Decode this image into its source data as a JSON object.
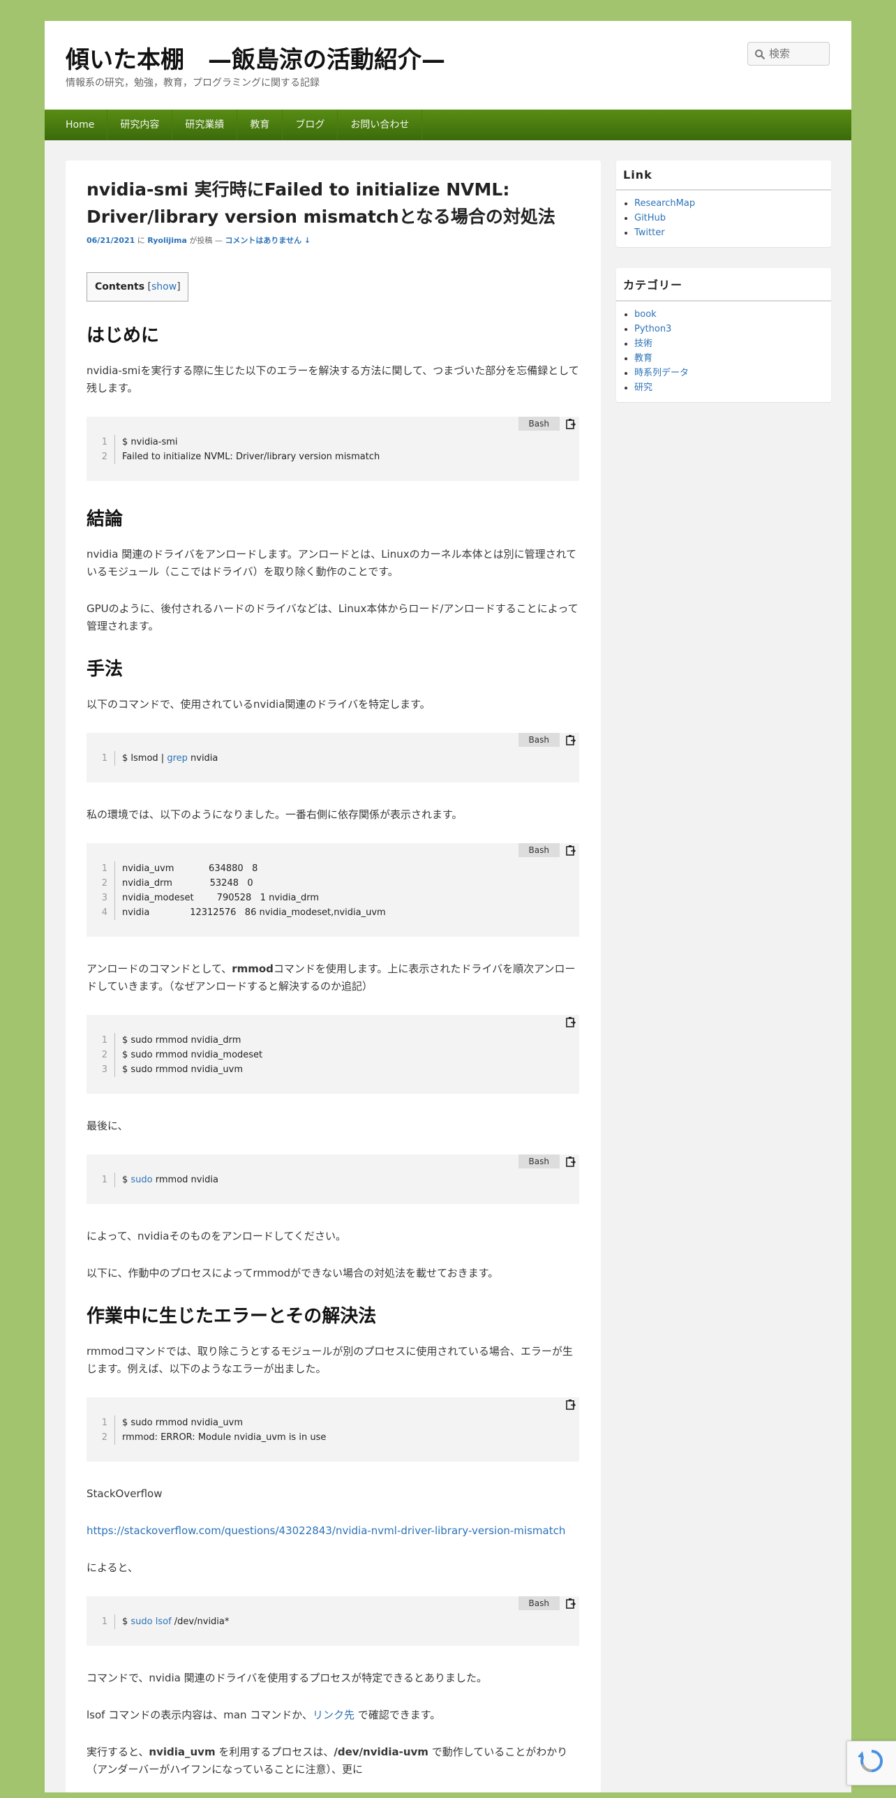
{
  "header": {
    "site_title": "傾いた本棚　—飯島涼の活動紹介—",
    "site_description": "情報系の研究，勉強，教育，プログラミングに関する記録",
    "search_placeholder": "検索"
  },
  "nav": {
    "items": [
      "Home",
      "研究内容",
      "研究業績",
      "教育",
      "ブログ",
      "お問い合わせ"
    ]
  },
  "post": {
    "title": "nvidia-smi 実行時にFailed to initialize NVML: Driver/library version mismatchとなる場合の対処法",
    "meta": {
      "date": "06/21/2021",
      "date_suffix": "に",
      "author": "Ryolijima",
      "author_suffix": "が投稿 —",
      "comments": "コメントはありません ↓"
    },
    "toc": {
      "label": "Contents",
      "toggle_open": "[",
      "toggle": "show",
      "toggle_close": "]"
    },
    "h_intro": "はじめに",
    "p_intro": "nvidia-smiを実行する際に生じた以下のエラーを解決する方法に関して、つまづいた部分を忘備録として残します。",
    "code1": {
      "lang": "Bash",
      "lines": [
        [
          "1",
          "$ nvidia-smi"
        ],
        [
          "2",
          "Failed to initialize NVML: Driver/library version mismatch"
        ]
      ]
    },
    "h_conclusion": "結論",
    "p_conclusion1": "nvidia 関連のドライバをアンロードします。アンロードとは、Linuxのカーネル本体とは別に管理されているモジュール（ここではドライバ）を取り除く動作のことです。",
    "p_conclusion2": "GPUのように、後付されるハードのドライバなどは、Linux本体からロード/アンロードすることによって管理されます。",
    "h_method": "手法",
    "p_method": "以下のコマンドで、使用されているnvidia関連のドライバを特定します。",
    "code2": {
      "lang": "Bash",
      "ln": "1",
      "prefix": "$ lsmod | ",
      "kw": "grep",
      "suffix": " nvidia"
    },
    "p_env": "私の環境では、以下のようになりました。一番右側に依存関係が表示されます。",
    "code3": {
      "lang": "Bash",
      "lines": [
        [
          "1",
          "nvidia_uvm            634880   8"
        ],
        [
          "2",
          "nvidia_drm             53248   0"
        ],
        [
          "3",
          "nvidia_modeset        790528   1 nvidia_drm"
        ],
        [
          "4",
          "nvidia              12312576   86 nvidia_modeset,nvidia_uvm"
        ]
      ]
    },
    "p_unload_a": "アンロードのコマンドとして、",
    "p_unload_b": "rmmod",
    "p_unload_c": "コマンドを使用します。上に表示されたドライバを順次アンロードしていきます。（なぜアンロードすると解決するのか追記）",
    "code4": {
      "lines": [
        [
          "1",
          "$ sudo rmmod nvidia_drm"
        ],
        [
          "2",
          "$ sudo rmmod nvidia_modeset"
        ],
        [
          "3",
          "$ sudo rmmod nvidia_uvm"
        ]
      ]
    },
    "p_finally": "最後に、",
    "code5": {
      "lang": "Bash",
      "ln": "1",
      "prefix": "$ ",
      "kw": "sudo",
      "suffix": " rmmod nvidia"
    },
    "p_after1": "によって、nvidiaそのものをアンロードしてください。",
    "p_after2": "以下に、作動中のプロセスによってrmmodができない場合の対処法を載せておきます。",
    "h_error": "作業中に生じたエラーとその解決法",
    "p_error": "rmmodコマンドでは、取り除こうとするモジュールが別のプロセスに使用されている場合、エラーが生じます。例えば、以下のようなエラーが出ました。",
    "code6": {
      "lines": [
        [
          "1",
          "$ sudo rmmod nvidia_uvm"
        ],
        [
          "2",
          "rmmod: ERROR: Module nvidia_uvm is in use"
        ]
      ]
    },
    "p_so": "StackOverflow",
    "p_link": "https://stackoverflow.com/questions/43022843/nvidia-nvml-driver-library-version-mismatch",
    "p_accord": "によると、",
    "code7": {
      "lang": "Bash",
      "ln": "1",
      "prefix": "$ ",
      "kw": "sudo lsof",
      "suffix": " /dev/nvidia*"
    },
    "p_lsof1": "コマンドで、nvidia 関連のドライバを使用するプロセスが特定できるとありました。",
    "p_lsof2_a": "lsof コマンドの表示内容は、man コマンドか、",
    "p_lsof2_link": "リンク先",
    "p_lsof2_b": " で確認できます。",
    "p_last_a": "実行すると、",
    "p_last_b": "nvidia_uvm",
    "p_last_c": " を利用するプロセスは、",
    "p_last_d": "/dev/nvidia-uvm",
    "p_last_e": " で動作していることがわかり（アンダーバーがハイフンになっていることに注意）、更に"
  },
  "sidebar": {
    "link_title": "Link",
    "links": [
      "ResearchMap",
      "GitHub",
      "Twitter"
    ],
    "cat_title": "カテゴリー",
    "categories": [
      "book",
      "Python3",
      "技術",
      "教育",
      "時系列データ",
      "研究"
    ]
  },
  "colors": {
    "background": "#a3c46e",
    "nav": "#4a7a10",
    "link": "#2b72b8"
  }
}
